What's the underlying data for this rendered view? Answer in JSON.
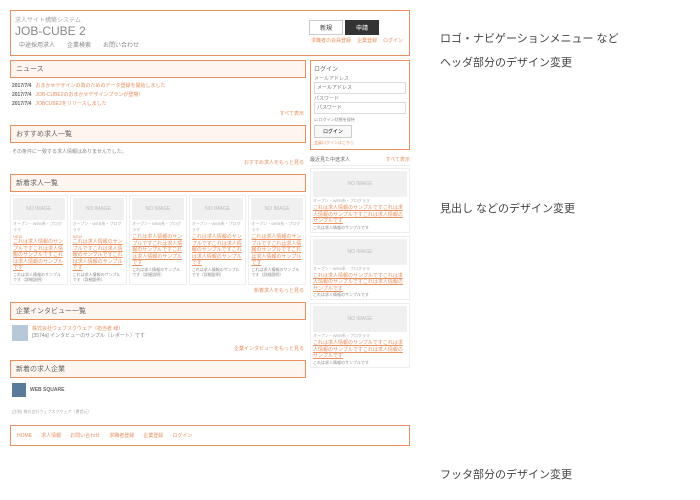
{
  "header": {
    "tagline": "求人サイト構築システム",
    "logo": "JOB-CUBE 2",
    "btn_left": "新規",
    "btn_right": "申請",
    "links": [
      "求職者の会員登録",
      "企業登録",
      "ログイン"
    ],
    "nav": [
      "中途採用求人",
      "企業検索",
      "お問い合わせ"
    ]
  },
  "news": {
    "heading": "ニュース",
    "items": [
      {
        "date": "2017/7/4",
        "text": "おまかせデザインの為のためのデータ登録を開始しました"
      },
      {
        "date": "2017/7/4",
        "text": "JOB-CUBE2のおまかせデザインプランが登場！"
      },
      {
        "date": "2017/7/4",
        "text": "JOBCUBE2をリリースしました"
      }
    ],
    "more": "すべて表示"
  },
  "featured": {
    "heading": "おすすめ求人一覧",
    "empty": "その条件に一致する求人情報はありませんでした。",
    "more": "おすすめ求人をもっと見る"
  },
  "newjobs": {
    "heading": "新着求人一覧",
    "noimg": "NO IMAGE",
    "meta": "オープン・WEB系・プログラマ",
    "new": "NEW",
    "title": "これは求人情報のサンプルですこれは求人情報のサンプルですこれは求人情報のサンプルです",
    "desc": "これは求人情報のサンプルです（詳細説明）",
    "more": "新着求人をもっと見る"
  },
  "interview": {
    "heading": "企業インタビュー一覧",
    "name": "株式会社ウェブスクウェア（担当者 様）",
    "text": "[3574a] インタビューのサンプル（レポート）です",
    "more": "企業インタビューをもっと見る"
  },
  "companies": {
    "heading": "新着の求人企業",
    "name": "WEB SQUARE"
  },
  "copyright": "[注釈] 株式会社ウェブスクウェア（運営元）",
  "login": {
    "heading": "ログイン",
    "email_label": "メールアドレス",
    "email_ph": "メールアドレス",
    "pass_label": "パスワード",
    "pass_ph": "パスワード",
    "remember": "ログイン状態を保持",
    "submit": "ログイン",
    "forgot": "会員ログインはこちら"
  },
  "recent": {
    "heading": "最近見た中途求人",
    "all": "すべて表示",
    "noimg": "NO IMAGE",
    "meta": "オープン・WEB系・プログラマ",
    "title": "これは求人情報のサンプルですこれは求人情報のサンプルですこれは求人情報のサンプルです",
    "desc": "これは求人情報のサンプルです"
  },
  "footer": {
    "links": [
      "HOME",
      "求人情報",
      "お問い合わせ",
      "求職者登録",
      "企業登録",
      "ログイン"
    ]
  },
  "annotations": {
    "a1": "ロゴ・ナビゲーションメニュー など",
    "a2": "ヘッダ部分のデザイン変更",
    "a3": "見出し などのデザイン変更",
    "a4": "フッタ部分のデザイン変更"
  }
}
